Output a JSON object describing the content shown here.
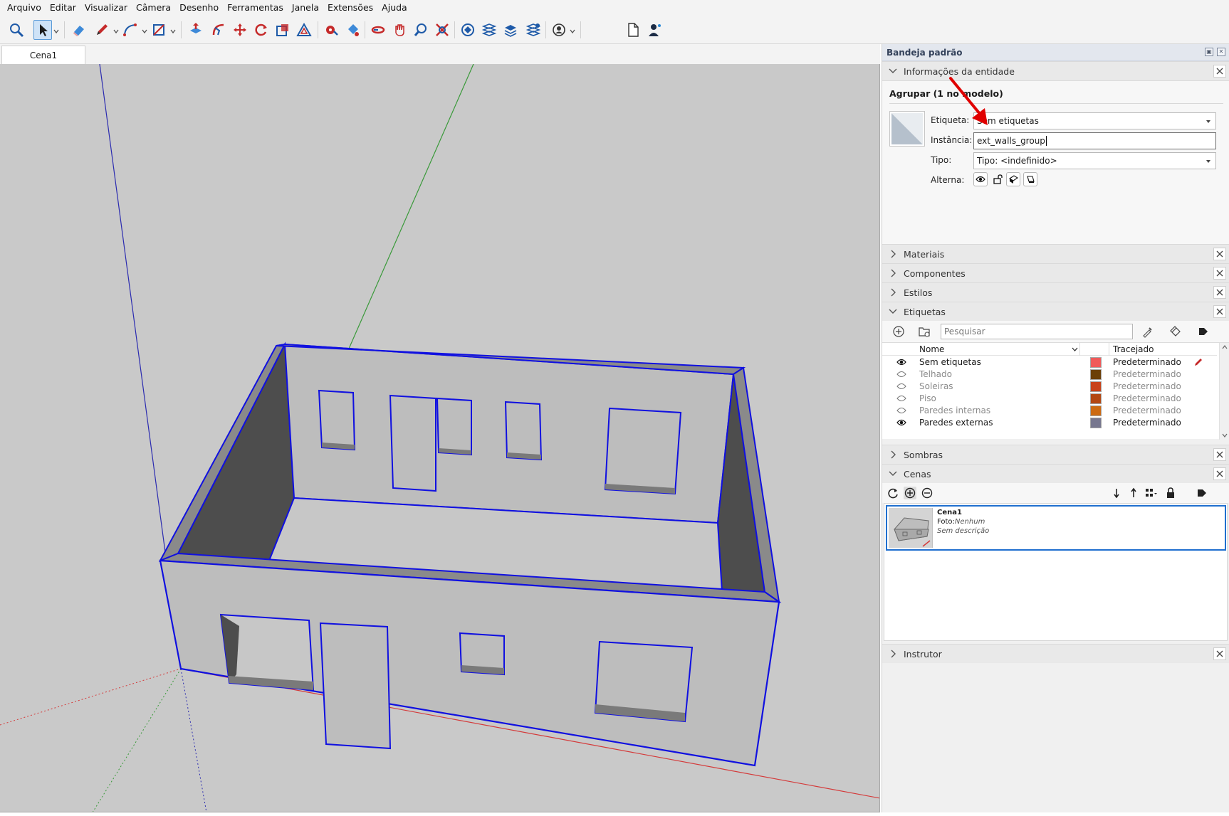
{
  "menu": [
    "Arquivo",
    "Editar",
    "Visualizar",
    "Câmera",
    "Desenho",
    "Ferramentas",
    "Janela",
    "Extensões",
    "Ajuda"
  ],
  "scene_tab": "Cena1",
  "tray": {
    "title": "Bandeja padrão",
    "entity_info": {
      "header": "Informações da entidade",
      "title": "Agrupar (1 no modelo)",
      "tag_label": "Etiqueta:",
      "tag_value": "Sem etiquetas",
      "instance_label": "Instância:",
      "instance_value": "ext_walls_group",
      "type_label": "Tipo:",
      "type_value": "Tipo: <indefinido>",
      "toggles_label": "Alterna:"
    },
    "collapsed_panels": [
      "Materiais",
      "Componentes",
      "Estilos"
    ],
    "tags": {
      "header": "Etiquetas",
      "search_placeholder": "Pesquisar",
      "col_name": "Nome",
      "col_dash": "Tracejado",
      "rows": [
        {
          "name": "Sem etiquetas",
          "color": "#f05a5a",
          "dash": "Predeterminado",
          "visible": true
        },
        {
          "name": "Telhado",
          "color": "#6b3f08",
          "dash": "Predeterminado",
          "visible": false
        },
        {
          "name": "Soleiras",
          "color": "#c8421a",
          "dash": "Predeterminado",
          "visible": false
        },
        {
          "name": "Piso",
          "color": "#b34713",
          "dash": "Predeterminado",
          "visible": false
        },
        {
          "name": "Paredes internas",
          "color": "#cc6a12",
          "dash": "Predeterminado",
          "visible": false
        },
        {
          "name": "Paredes externas",
          "color": "#77778f",
          "dash": "Predeterminado",
          "visible": true
        }
      ]
    },
    "shadows": "Sombras",
    "scenes": {
      "header": "Cenas",
      "scene_name": "Cena1",
      "photo_label": "Foto:",
      "photo_value": "Nenhum",
      "description": "Sem descrição"
    },
    "instructor": "Instrutor"
  },
  "colors": {
    "selection": "#1010e0",
    "wall": "#bdbdbd",
    "wall_dark": "#4d4d4d",
    "axis_red": "#d43a3a",
    "axis_green": "#3a9a3a",
    "axis_blue": "#2b2bb0",
    "annotation_arrow": "#e00000"
  }
}
